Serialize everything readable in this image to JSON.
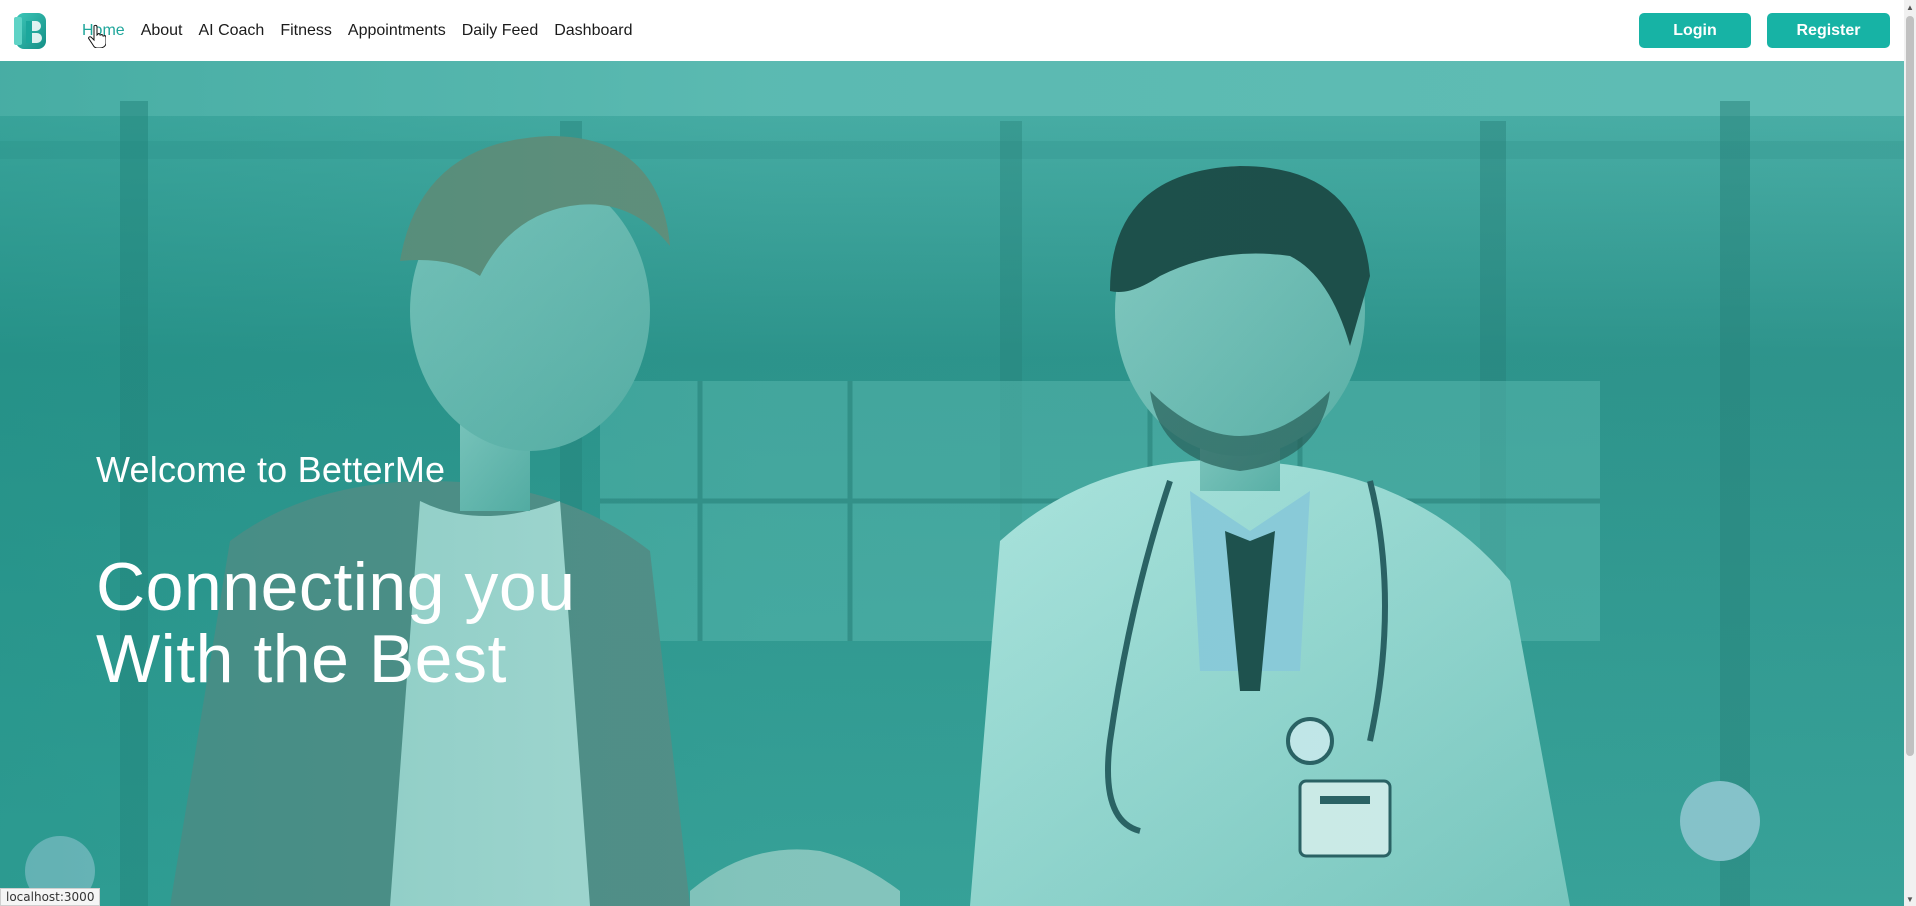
{
  "nav": {
    "logo": "B-logo-icon",
    "links": [
      {
        "label": "Home",
        "active": true
      },
      {
        "label": "About"
      },
      {
        "label": "AI Coach"
      },
      {
        "label": "Fitness"
      },
      {
        "label": "Appointments"
      },
      {
        "label": "Daily Feed"
      },
      {
        "label": "Dashboard"
      }
    ],
    "login_label": "Login",
    "register_label": "Register"
  },
  "hero": {
    "welcome": "Welcome to BetterMe",
    "title_line1": "Connecting you",
    "title_line2": "With the Best",
    "image": "doctor-patient-handshake-photo"
  },
  "status_bar": {
    "url": "localhost:3000"
  },
  "colors": {
    "accent": "#17b3a5",
    "active_link": "#1fa69b",
    "hero_tint": "#2c9a91"
  }
}
